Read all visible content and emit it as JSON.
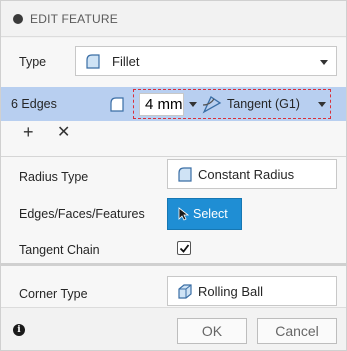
{
  "header": {
    "title": "EDIT FEATURE"
  },
  "type_row": {
    "label": "Type",
    "value": "Fillet"
  },
  "selection_row": {
    "edges_label": "6 Edges",
    "radius_value": "4 mm",
    "continuity_value": "Tangent (G1)"
  },
  "radius_type": {
    "label": "Radius Type",
    "value": "Constant Radius"
  },
  "edges_faces": {
    "label": "Edges/Faces/Features",
    "button_label": "Select"
  },
  "tangent_chain": {
    "label": "Tangent Chain",
    "checked": true
  },
  "corner_type": {
    "label": "Corner Type",
    "value": "Rolling Ball"
  },
  "footer": {
    "ok_label": "OK",
    "cancel_label": "Cancel"
  },
  "colors": {
    "accent": "#1f8ed4",
    "selection_highlight": "#b8cff0",
    "dashed_outline": "#d9303a"
  },
  "icons": [
    "collapse-icon",
    "fillet-icon",
    "tangent-icon",
    "add-icon",
    "remove-icon",
    "cursor-icon",
    "checkmark-icon",
    "rolling-ball-icon",
    "info-icon"
  ]
}
